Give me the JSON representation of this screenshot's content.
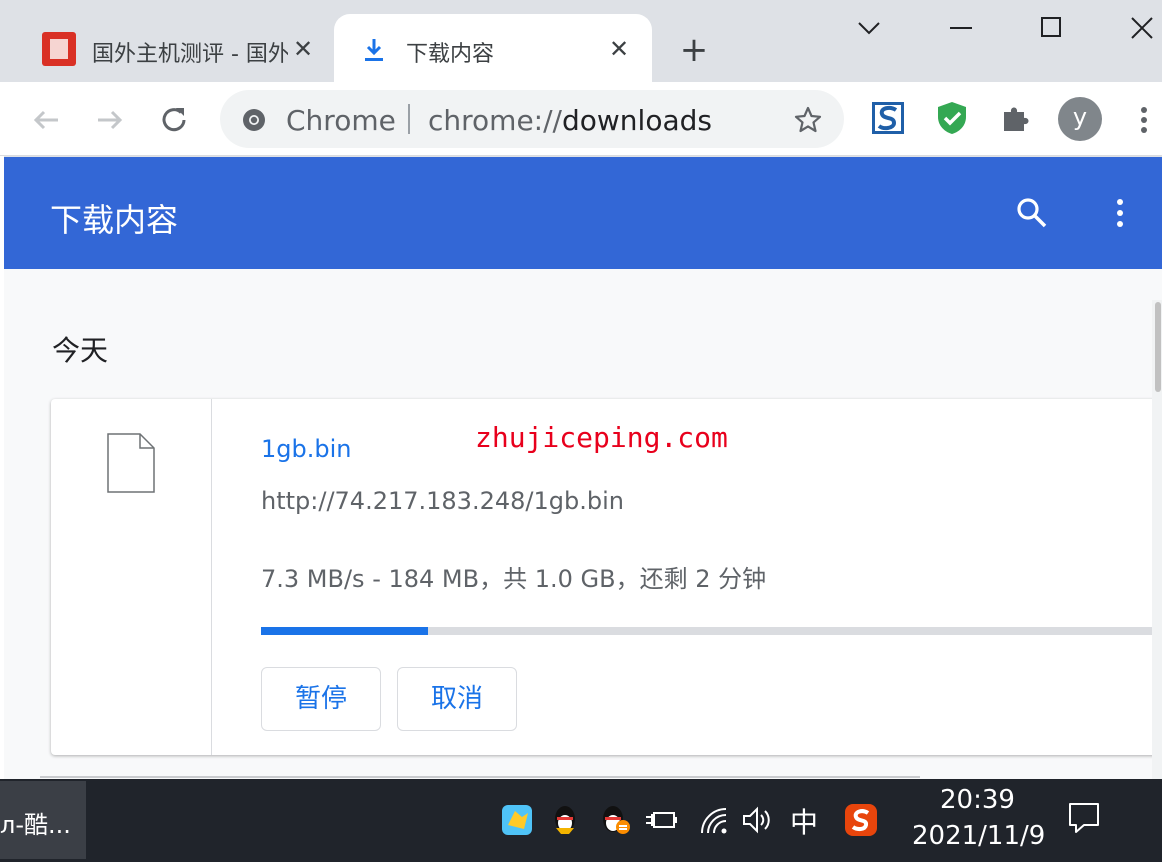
{
  "tabs": [
    {
      "title": "国外主机测评 - 国外",
      "close": "✕"
    },
    {
      "title": "下载内容",
      "close": "✕"
    }
  ],
  "new_tab": "+",
  "omnibox": {
    "chip": "Chrome",
    "url_prefix": "chrome://",
    "url_path": "downloads"
  },
  "profile": {
    "initial": "y"
  },
  "downloads": {
    "page_title": "下载内容",
    "section_date": "今天",
    "item": {
      "file_name": "1gb.bin",
      "url": "http://74.217.183.248/1gb.bin",
      "status": "7.3 MB/s - 184 MB，共 1.0 GB，还剩 2 分钟",
      "progress": 0.184,
      "pause_label": "暂停",
      "cancel_label": "取消"
    },
    "watermark": "zhujiceping.com"
  },
  "taskbar": {
    "task_label": "л-酷...",
    "ime": "中",
    "time": "20:39",
    "date": "2021/11/9"
  },
  "colors": {
    "accent": "#3367d6",
    "link": "#1a73e8",
    "watermark": "#e8001c"
  }
}
